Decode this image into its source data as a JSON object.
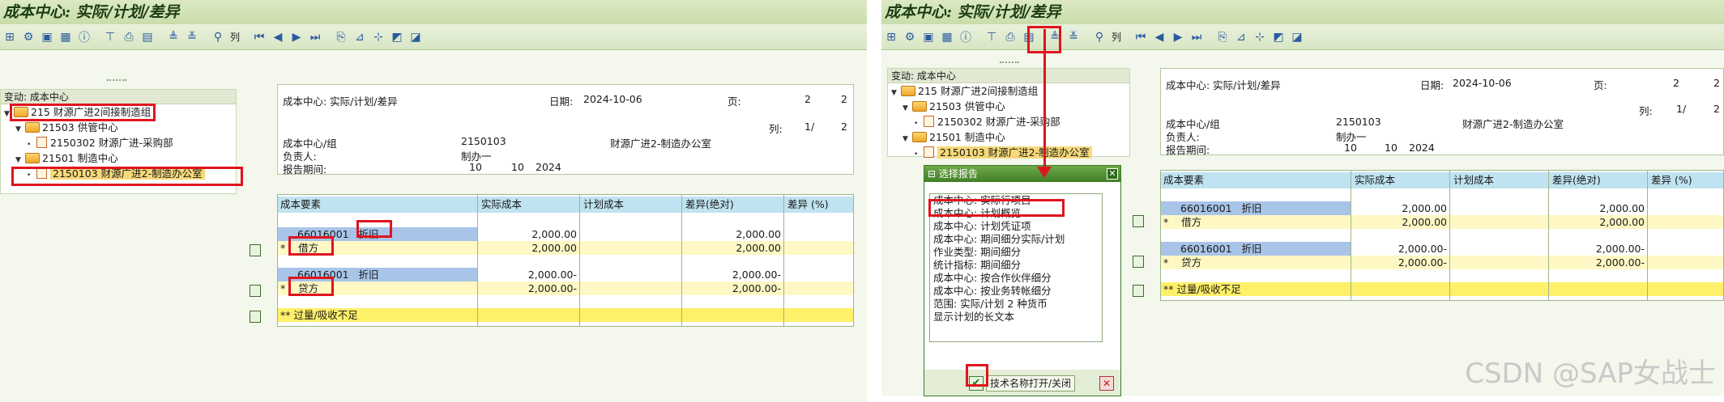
{
  "screen1": {
    "title": "成本中心: 实际/计划/差异",
    "toolbar": {
      "columns_label": "列"
    },
    "tree": {
      "header": "变动: 成本中心",
      "items": [
        {
          "code": "215",
          "label": "财源广进2间接制造组"
        },
        {
          "code": "21503",
          "label": "供管中心"
        },
        {
          "code": "2150302",
          "label": "财源广进-采购部"
        },
        {
          "code": "21501",
          "label": "制造中心"
        },
        {
          "code": "2150103",
          "label": "财源广进2-制造办公室"
        }
      ]
    },
    "header": {
      "title": "成本中心: 实际/计划/差异",
      "date_label": "日期:",
      "date": "2024-10-06",
      "page_label": "页:",
      "page": "2",
      "page_total": "2",
      "col_label": "列:",
      "col": "1/",
      "col_total": "2",
      "cc_group_label": "成本中心/组",
      "cc_group_value": "2150103",
      "cc_group_name": "财源广进2-制造办公室",
      "responsible_label": "负责人:",
      "responsible_value": "制办一",
      "period_label": "报告期间:",
      "period_from": "10",
      "period_to": "10",
      "period_year": "2024"
    },
    "grid": {
      "columns": [
        "成本要素",
        "实际成本",
        "计划成本",
        "差异(绝对)",
        "差异 (%)"
      ],
      "rows": [
        {
          "element": "66016001",
          "name": "折旧",
          "actual": "2,000.00",
          "plan": "",
          "var_abs": "2,000.00",
          "var_pct": ""
        },
        {
          "star": "*",
          "element": "借方",
          "actual": "2,000.00",
          "plan": "",
          "var_abs": "2,000.00",
          "var_pct": ""
        },
        {
          "element": "66016001",
          "name": "折旧",
          "actual": "2,000.00-",
          "plan": "",
          "var_abs": "2,000.00-",
          "var_pct": ""
        },
        {
          "star": "*",
          "element": "贷方",
          "actual": "2,000.00-",
          "plan": "",
          "var_abs": "2,000.00-",
          "var_pct": ""
        },
        {
          "star": "**",
          "element": "过量/吸收不足",
          "actual": "",
          "plan": "",
          "var_abs": "",
          "var_pct": ""
        }
      ]
    }
  },
  "screen2": {
    "title": "成本中心: 实际/计划/差异",
    "toolbar": {
      "columns_label": "列"
    },
    "tree": {
      "header": "变动: 成本中心",
      "items": [
        {
          "code": "215",
          "label": "财源广进2间接制造组"
        },
        {
          "code": "21503",
          "label": "供管中心"
        },
        {
          "code": "2150302",
          "label": "财源广进-采购部"
        },
        {
          "code": "21501",
          "label": "制造中心"
        },
        {
          "code": "2150103",
          "label": "财源广进2-制造办公室"
        }
      ]
    },
    "header": {
      "title": "成本中心: 实际/计划/差异",
      "date_label": "日期:",
      "date": "2024-10-06",
      "page_label": "页:",
      "page": "2",
      "page_total": "2",
      "col_label": "列:",
      "col": "1/",
      "col_total": "2",
      "cc_group_label": "成本中心/组",
      "cc_group_value": "2150103",
      "cc_group_name": "财源广进2-制造办公室",
      "responsible_label": "负责人:",
      "responsible_value": "制办一",
      "period_label": "报告期间:",
      "period_from": "10",
      "period_to": "10",
      "period_year": "2024"
    },
    "grid": {
      "columns": [
        "成本要素",
        "实际成本",
        "计划成本",
        "差异(绝对)",
        "差异 (%)"
      ],
      "rows": [
        {
          "element": "66016001",
          "name": "折旧",
          "actual": "2,000.00",
          "plan": "",
          "var_abs": "2,000.00",
          "var_pct": ""
        },
        {
          "star": "*",
          "element": "借方",
          "actual": "2,000.00",
          "plan": "",
          "var_abs": "2,000.00",
          "var_pct": ""
        },
        {
          "element": "66016001",
          "name": "折旧",
          "actual": "2,000.00-",
          "plan": "",
          "var_abs": "2,000.00-",
          "var_pct": ""
        },
        {
          "star": "*",
          "element": "贷方",
          "actual": "2,000.00-",
          "plan": "",
          "var_abs": "2,000.00-",
          "var_pct": ""
        },
        {
          "star": "**",
          "element": "过量/吸收不足",
          "actual": "",
          "plan": "",
          "var_abs": "",
          "var_pct": ""
        }
      ]
    },
    "dialog": {
      "title": "选择报告",
      "items": [
        "成本中心: 实际行项目",
        "成本中心: 计划概览",
        "成本中心: 计划凭证项",
        "成本中心: 期间细分实际/计划",
        "作业类型: 期间细分",
        "统计指标: 期间细分",
        "成本中心: 按合作伙伴细分",
        "成本中心: 按业务转帐细分",
        "范围: 实际/计划 2 种货币",
        "显示计划的长文本"
      ],
      "tech_button": "技术名称打开/关闭"
    }
  },
  "watermark": "CSDN @SAP女战士",
  "colors": {
    "highlight": "#e0141e",
    "column_header": "#bfe3f0",
    "total_row": "#fff06a"
  }
}
